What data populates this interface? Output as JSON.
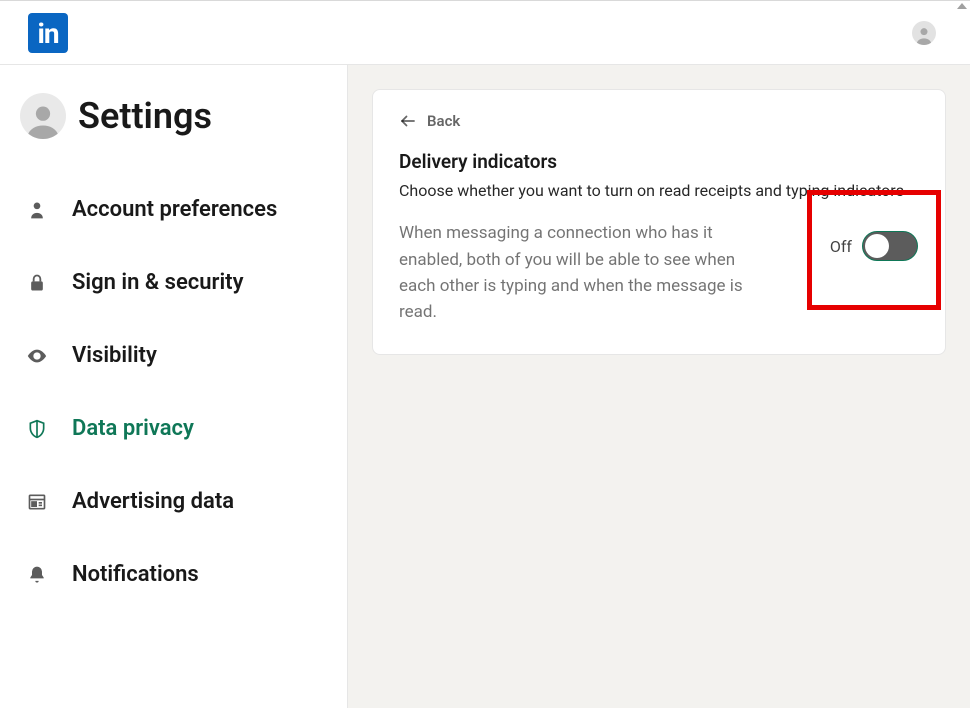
{
  "header": {
    "logo_text": "in"
  },
  "settings": {
    "title": "Settings"
  },
  "sidebar": {
    "items": [
      {
        "label": "Account preferences",
        "icon": "person-icon",
        "active": false
      },
      {
        "label": "Sign in & security",
        "icon": "lock-icon",
        "active": false
      },
      {
        "label": "Visibility",
        "icon": "eye-icon",
        "active": false
      },
      {
        "label": "Data privacy",
        "icon": "shield-icon",
        "active": true
      },
      {
        "label": "Advertising data",
        "icon": "newspaper-icon",
        "active": false
      },
      {
        "label": "Notifications",
        "icon": "bell-icon",
        "active": false
      }
    ]
  },
  "main": {
    "back_label": "Back",
    "title": "Delivery indicators",
    "subtitle": "Choose whether you want to turn on read receipts and typing indicators",
    "description": "When messaging a connection who has it enabled, both of you will be able to see when each other is typing and when the message is read.",
    "toggle_state_label": "Off",
    "toggle_on": false
  }
}
